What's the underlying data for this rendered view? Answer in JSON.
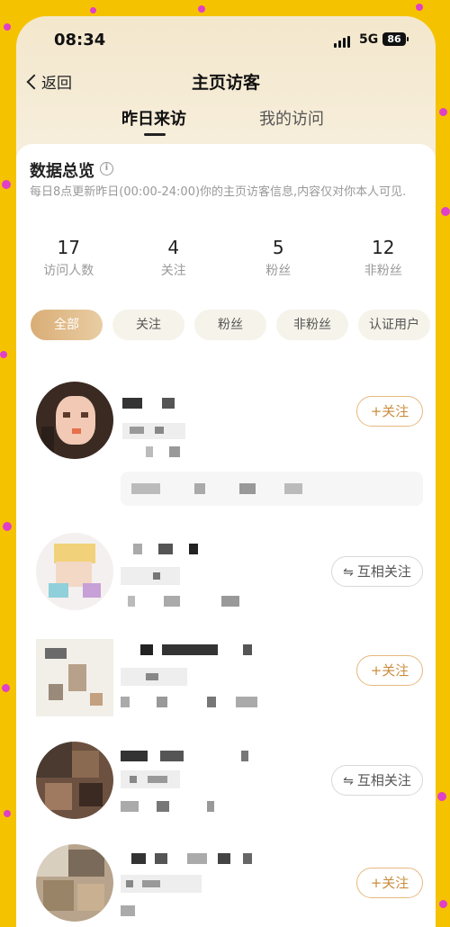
{
  "status_bar": {
    "time": "08:34",
    "network": "5G",
    "battery": "86"
  },
  "nav": {
    "back_label": "返回",
    "title": "主页访客"
  },
  "tabs": [
    {
      "label": "昨日来访",
      "active": true
    },
    {
      "label": "我的访问",
      "active": false
    }
  ],
  "overview": {
    "title": "数据总览",
    "info_icon": "i",
    "description": "每日8点更新昨日(00:00-24:00)你的主页访客信息,内容仅对你本人可见.",
    "stats": [
      {
        "value": "17",
        "label": "访问人数"
      },
      {
        "value": "4",
        "label": "关注"
      },
      {
        "value": "5",
        "label": "粉丝"
      },
      {
        "value": "12",
        "label": "非粉丝"
      }
    ]
  },
  "filters": [
    "全部",
    "关注",
    "粉丝",
    "非粉丝",
    "认证用户"
  ],
  "visitors": [
    {
      "action": "+关注",
      "action_type": "follow"
    },
    {
      "action": "互相关注",
      "action_type": "mutual"
    },
    {
      "action": "+关注",
      "action_type": "follow"
    },
    {
      "action": "互相关注",
      "action_type": "mutual"
    },
    {
      "action": "+关注",
      "action_type": "follow"
    }
  ],
  "icons": {
    "swap": "⇋",
    "back": "chevron-left",
    "plus": "+"
  },
  "colors": {
    "accent": "#d9ad76",
    "follow_text": "#c98d3f",
    "background": "#f5c200",
    "dots": "#e040c8"
  }
}
